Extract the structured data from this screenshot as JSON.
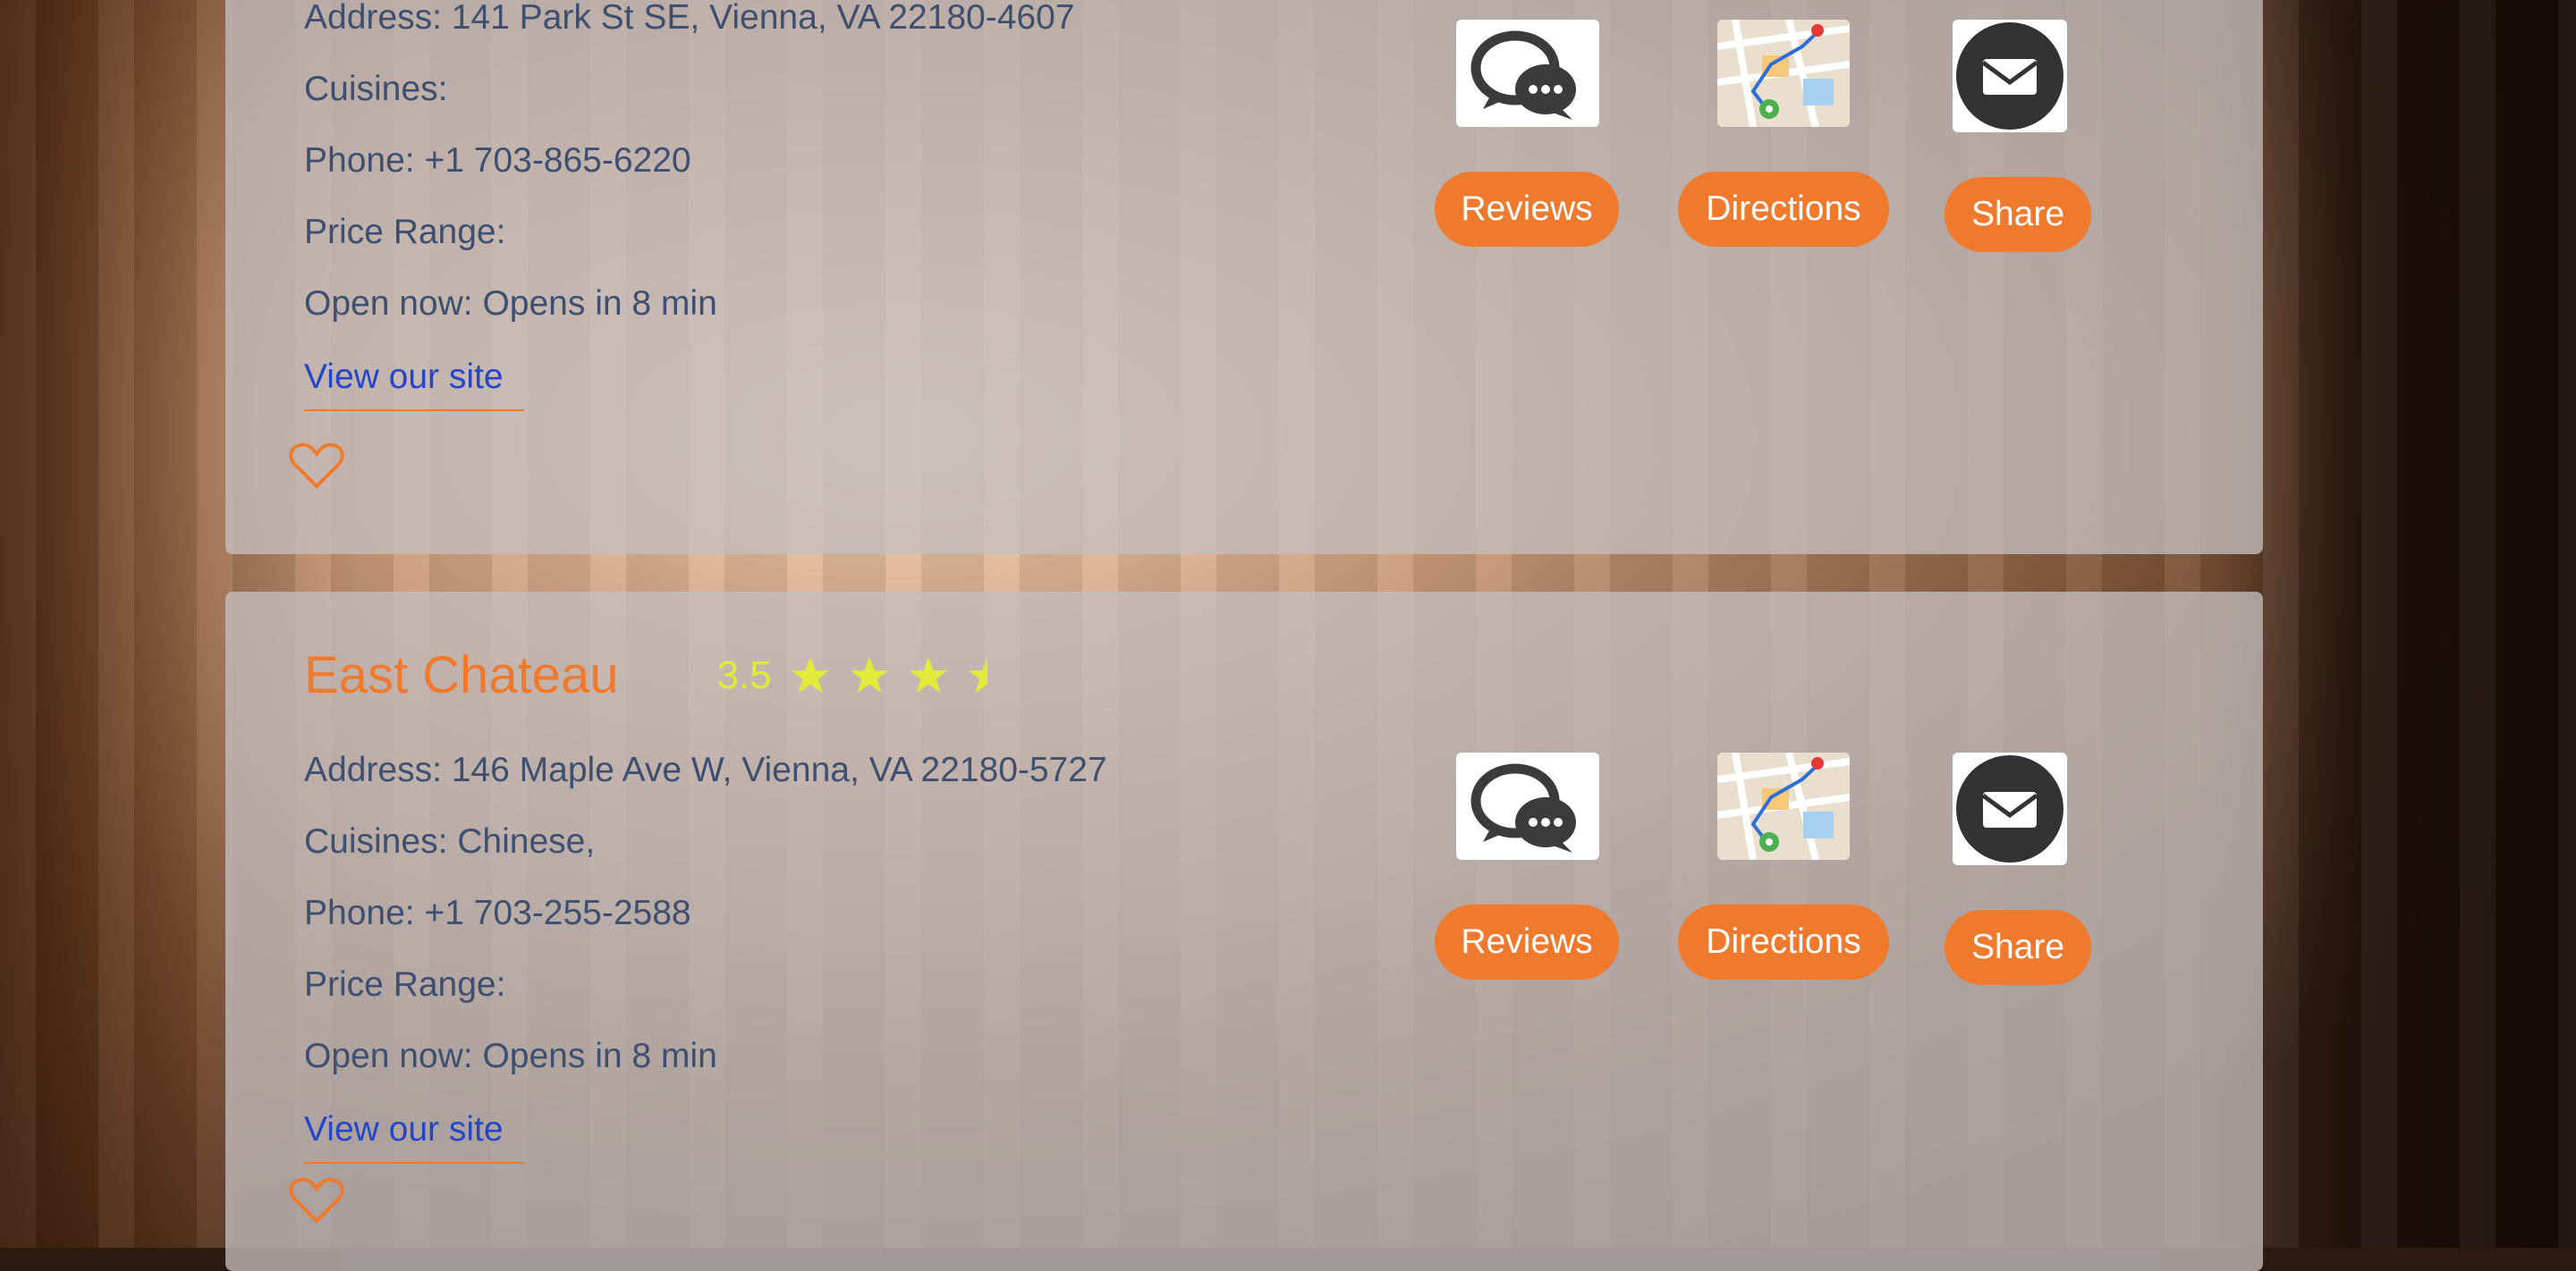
{
  "theme": {
    "accent": "#ef7a2e",
    "link": "#2446c8",
    "text": "#3f4f6f",
    "rating": "#e3ea3a"
  },
  "restaurants": [
    {
      "address": "Address: 141 Park St SE, Vienna, VA 22180-4607",
      "cuisines": "Cuisines:",
      "phone": "Phone: +1 703-865-6220",
      "price": "Price Range:",
      "open": "Open now: Opens in 8 min",
      "site_link": "View our site",
      "reviews_label": "Reviews",
      "directions_label": "Directions",
      "share_label": "Share",
      "icons": [
        "chat-icon",
        "map-icon",
        "mail-icon",
        "heart-icon"
      ]
    },
    {
      "name": "East Chateau",
      "rating_text": "3.5",
      "rating_value": 3.5,
      "rating_max": 5,
      "address": "Address: 146 Maple Ave W, Vienna, VA 22180-5727",
      "cuisines": "Cuisines: Chinese,",
      "phone": "Phone: +1 703-255-2588",
      "price": "Price Range:",
      "open": "Open now: Opens in 8 min",
      "site_link": "View our site",
      "reviews_label": "Reviews",
      "directions_label": "Directions",
      "share_label": "Share",
      "icons": [
        "chat-icon",
        "map-icon",
        "mail-icon",
        "heart-icon",
        "star-icon"
      ]
    }
  ]
}
